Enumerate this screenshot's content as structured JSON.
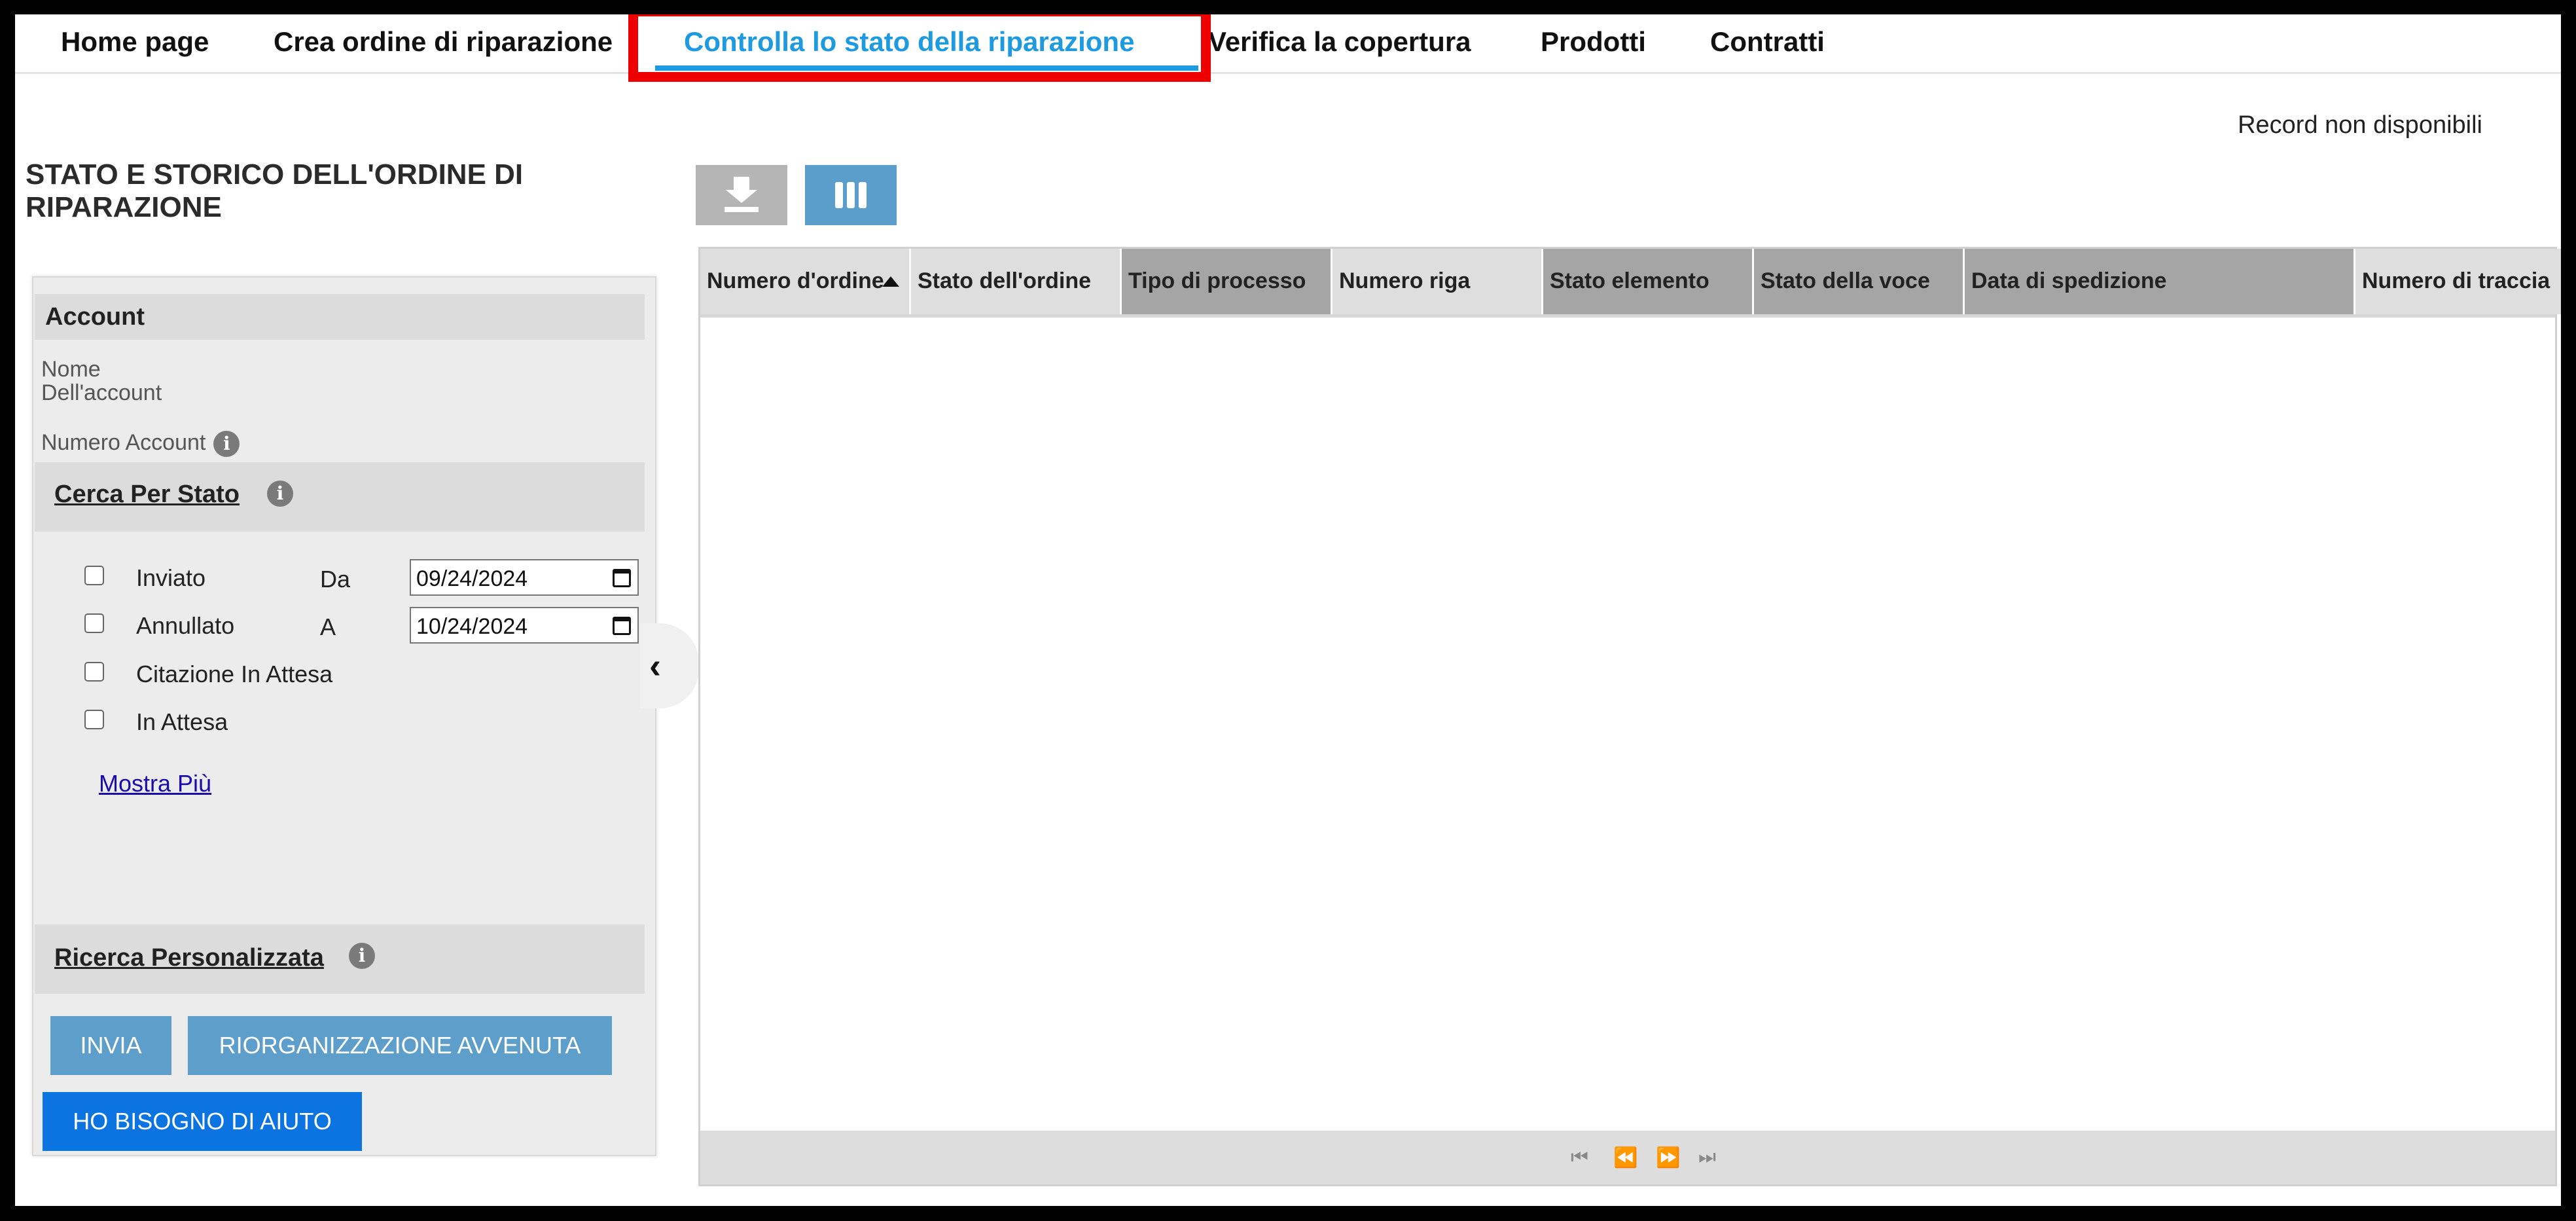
{
  "nav": {
    "items": [
      {
        "label": "Home page"
      },
      {
        "label": "Crea ordine di riparazione"
      },
      {
        "label": "Controlla lo stato della riparazione"
      },
      {
        "label": "Verifica la copertura"
      },
      {
        "label": "Prodotti"
      },
      {
        "label": "Contratti"
      }
    ],
    "active_index": 2,
    "active_color": "#1e9be0",
    "highlight_color": "#ee0000"
  },
  "page_title": "STATO E STORICO DELL'ORDINE DI RIPARAZIONE",
  "account": {
    "header": "Account",
    "name_label": "Nome Dell'account",
    "number_label": "Numero Account"
  },
  "cerca": {
    "header": "Cerca Per Stato",
    "options": [
      {
        "label": "Inviato"
      },
      {
        "label": "Annullato"
      },
      {
        "label": "Citazione In Attesa"
      },
      {
        "label": "In Attesa"
      }
    ],
    "from_label": "Da",
    "to_label": "A",
    "from_date": "09/24/2024",
    "to_date": "10/24/2024",
    "more_link": "Mostra Più"
  },
  "ricerca": {
    "header": "Ricerca Personalizzata"
  },
  "buttons": {
    "submit": "INVIA",
    "reset": "RIORGANIZZAZIONE AVVENUTA",
    "help": "HO BISOGNO DI AIUTO"
  },
  "icons": {
    "info": "info-icon",
    "download": "download-icon",
    "columns": "columns-icon",
    "collapse": "chevron-left-icon",
    "calendar": "calendar-icon"
  },
  "records_status": "Record non disponibili",
  "table": {
    "columns": [
      {
        "label": "Numero d'ordine"
      },
      {
        "label": "Stato dell'ordine"
      },
      {
        "label": "Tipo di processo"
      },
      {
        "label": "Numero riga"
      },
      {
        "label": "Stato elemento"
      },
      {
        "label": "Stato della voce"
      },
      {
        "label": "Data di spedizione"
      },
      {
        "label": "Numero di traccia"
      }
    ],
    "rows": []
  }
}
